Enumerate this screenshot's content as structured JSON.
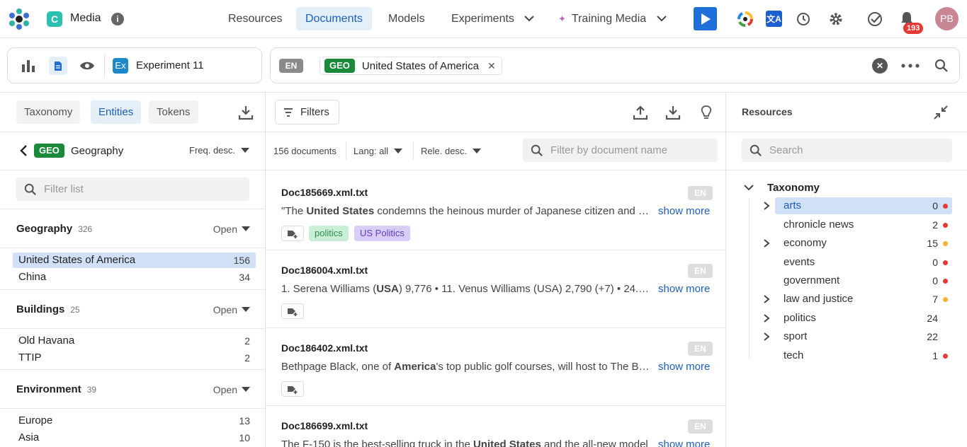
{
  "app": {
    "name": "Media",
    "badge_letter": "C",
    "brand_color": "#2bc0b0"
  },
  "nav": {
    "items": [
      {
        "label": "Resources",
        "active": false
      },
      {
        "label": "Documents",
        "active": true
      },
      {
        "label": "Models",
        "active": false
      },
      {
        "label": "Experiments",
        "active": false
      },
      {
        "label": "Training Media",
        "active": false
      }
    ],
    "notifications": "193",
    "avatar": "PB"
  },
  "experiment": {
    "badge": "Ex",
    "name": "Experiment 11"
  },
  "query": {
    "lang": "EN",
    "tag": "GEO",
    "value": "United States of America"
  },
  "left": {
    "tabs": [
      "Taxonomy",
      "Entities",
      "Tokens"
    ],
    "active_tab": "Entities",
    "header": {
      "tag": "GEO",
      "title": "Geography",
      "sort": "Freq. desc."
    },
    "filter_placeholder": "Filter list",
    "open_label": "Open",
    "groups": [
      {
        "title": "Geography",
        "count": "326",
        "items": [
          {
            "label": "United States of America",
            "count": "156",
            "selected": true
          },
          {
            "label": "China",
            "count": "34"
          }
        ]
      },
      {
        "title": "Buildings",
        "count": "25",
        "items": [
          {
            "label": "Old Havana",
            "count": "2"
          },
          {
            "label": "TTIP",
            "count": "2"
          }
        ]
      },
      {
        "title": "Environment",
        "count": "39",
        "items": [
          {
            "label": "Europe",
            "count": "13"
          },
          {
            "label": "Asia",
            "count": "10"
          }
        ]
      }
    ]
  },
  "center": {
    "filters_label": "Filters",
    "doc_count": "156 documents",
    "lang_filter": "Lang: all",
    "sort": "Rele. desc.",
    "search_placeholder": "Filter by document name",
    "show_more": "show more",
    "docs": [
      {
        "name": "Doc185669.xml.txt",
        "lang": "EN",
        "pre": "\"The ",
        "bold": "United States",
        "post": " condemns the heinous murder of Japanese citizen and journalist",
        "tags": [
          "politics",
          "US Politics"
        ]
      },
      {
        "name": "Doc186004.xml.txt",
        "lang": "EN",
        "pre": "1. Serena Williams (",
        "bold": "USA",
        "post": ") 9,776  •  11. Venus Williams (USA) 2,790 (+7)  •  24. ...",
        "tags": []
      },
      {
        "name": "Doc186402.xml.txt",
        "lang": "EN",
        "pre": "Bethpage Black, one of ",
        "bold": "America",
        "post": "'s top public golf courses, will host to The Barclays",
        "tags": []
      },
      {
        "name": "Doc186699.xml.txt",
        "lang": "EN",
        "pre": "The F-150 is the best-selling truck in the ",
        "bold": "United States",
        "post": " and the all-new model",
        "tags": []
      }
    ]
  },
  "right": {
    "title": "Resources",
    "search_placeholder": "Search",
    "root": "Taxonomy",
    "items": [
      {
        "label": "arts",
        "count": "0",
        "dot": "#e53935",
        "expandable": true,
        "selected": true
      },
      {
        "label": "chronicle news",
        "count": "2",
        "dot": "#e53935",
        "expandable": false
      },
      {
        "label": "economy",
        "count": "15",
        "dot": "#f9b233",
        "expandable": true
      },
      {
        "label": "events",
        "count": "0",
        "dot": "#e53935",
        "expandable": false
      },
      {
        "label": "government",
        "count": "0",
        "dot": "#e53935",
        "expandable": false
      },
      {
        "label": "law and justice",
        "count": "7",
        "dot": "#f9b233",
        "expandable": true
      },
      {
        "label": "politics",
        "count": "24",
        "dot": "",
        "expandable": true
      },
      {
        "label": "sport",
        "count": "22",
        "dot": "",
        "expandable": true
      },
      {
        "label": "tech",
        "count": "1",
        "dot": "#e53935",
        "expandable": false
      }
    ]
  }
}
